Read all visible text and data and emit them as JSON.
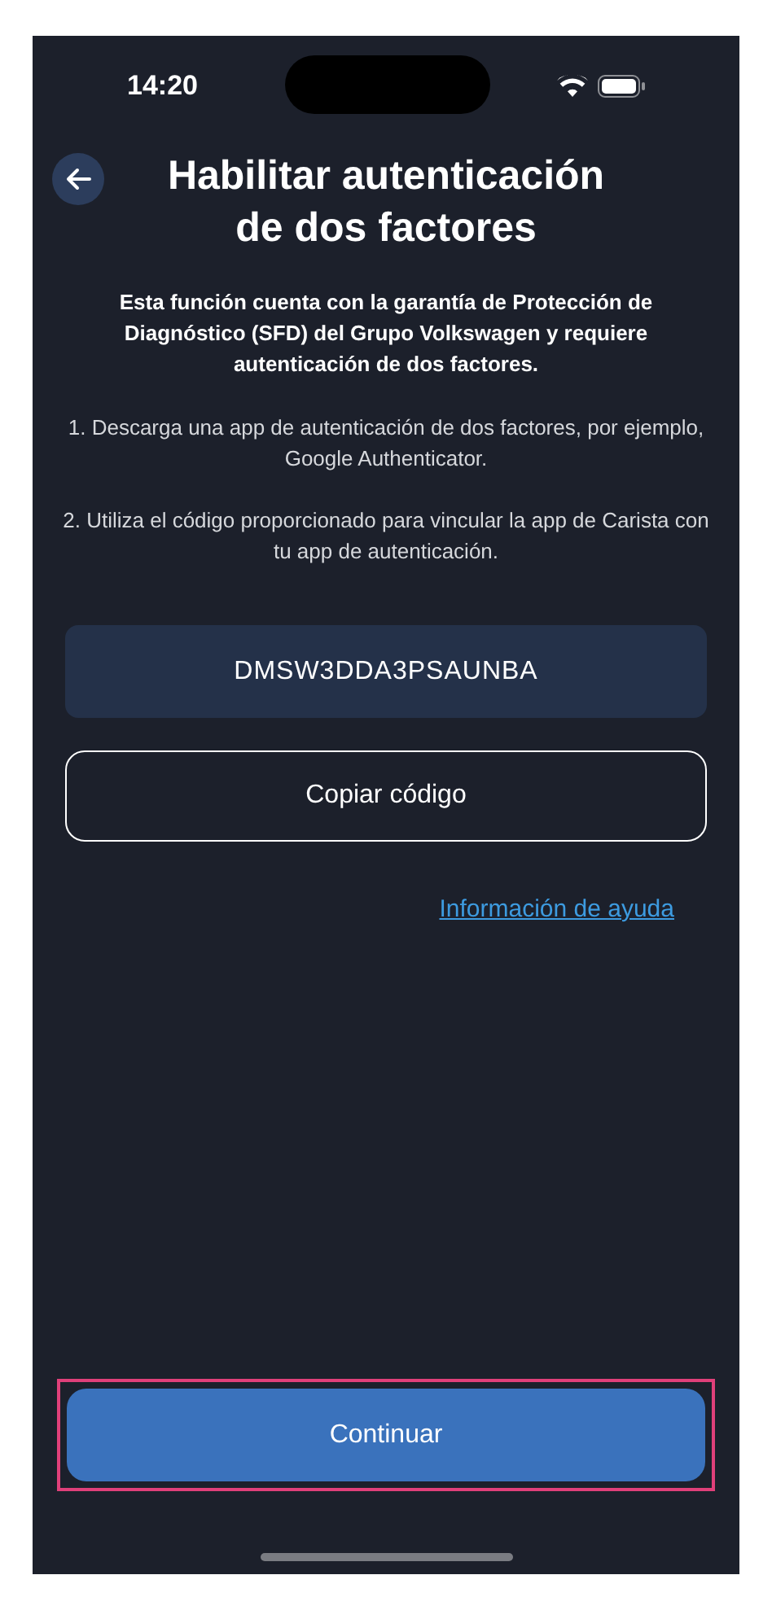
{
  "status_bar": {
    "time": "14:20"
  },
  "header": {
    "title": "Habilitar autenticación de dos factores"
  },
  "notice": "Esta función cuenta con la garantía de Protección de Diagnóstico (SFD) del Grupo Volkswagen y requiere autenticación de dos factores.",
  "steps": [
    "1. Descarga una app de autenticación de dos factores, por ejemplo, Google Authenticator.",
    "2. Utiliza el código proporcionado para vincular la app de Carista con tu app de autenticación."
  ],
  "code": "DMSW3DDA3PSAUNBA",
  "copy_button": "Copiar código",
  "help_link": "Información de ayuda",
  "continue_button": {
    "label": "Continuar",
    "highlighted": true
  }
}
